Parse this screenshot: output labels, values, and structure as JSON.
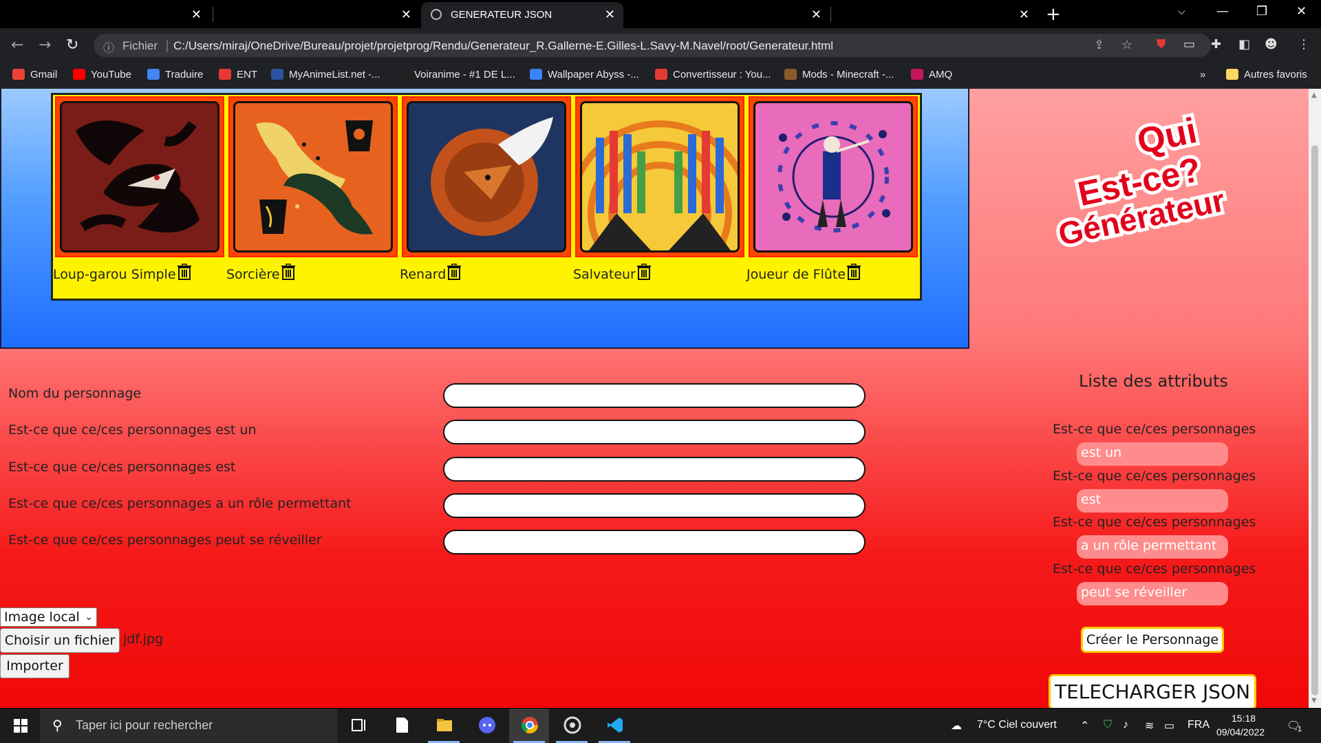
{
  "browser": {
    "active_tab_title": "GENERATEUR JSON",
    "address_scheme": "Fichier",
    "url": "C:/Users/miraj/OneDrive/Bureau/projet/projetprog/Rendu/Generateur_R.Gallerne-E.Gilles-L.Savy-M.Navel/root/Generateur.html",
    "bookmarks": [
      {
        "label": "Gmail",
        "color": "#ea4335"
      },
      {
        "label": "YouTube",
        "color": "#ff0000"
      },
      {
        "label": "Traduire",
        "color": "#4285f4"
      },
      {
        "label": "ENT",
        "color": "#e53935"
      },
      {
        "label": "MyAnimeList.net -...",
        "color": "#2e51a2"
      },
      {
        "label": "Voiranime - #1 DE L...",
        "color": "#222222"
      },
      {
        "label": "Wallpaper Abyss -...",
        "color": "#3b82f6"
      },
      {
        "label": "Convertisseur : You...",
        "color": "#e53935"
      },
      {
        "label": "Mods - Minecraft -...",
        "color": "#8b5a2b"
      },
      {
        "label": "AMQ",
        "color": "#c2185b"
      }
    ],
    "bookmarks_more": "»",
    "other_bookmarks": "Autres favoris"
  },
  "gallery": {
    "cards": [
      {
        "label": "Loup-garou Simple"
      },
      {
        "label": "Sorcière"
      },
      {
        "label": "Renard"
      },
      {
        "label": "Salvateur"
      },
      {
        "label": "Joueur de Flûte"
      }
    ]
  },
  "logo": {
    "line1": "Qui",
    "line2": "Est-ce?",
    "line3": "Générateur"
  },
  "form": {
    "fields": [
      {
        "label": "Nom du personnage",
        "value": ""
      },
      {
        "label": "Est-ce que ce/ces personnages est un",
        "value": ""
      },
      {
        "label": "Est-ce que ce/ces personnages est",
        "value": ""
      },
      {
        "label": "Est-ce que ce/ces personnages a un rôle permettant",
        "value": ""
      },
      {
        "label": "Est-ce que ce/ces personnages peut se réveiller",
        "value": ""
      }
    ],
    "image_source": "Image local",
    "choose_file": "Choisir un fichier",
    "file_name": "jdf.jpg",
    "import": "Importer"
  },
  "attributes": {
    "title": "Liste des attributs",
    "items": [
      {
        "question": "Est-ce que ce/ces personnages",
        "value": "est un"
      },
      {
        "question": "Est-ce que ce/ces personnages",
        "value": "est"
      },
      {
        "question": "Est-ce que ce/ces personnages",
        "value": "a un rôle permettant"
      },
      {
        "question": "Est-ce que ce/ces personnages",
        "value": "peut se réveiller"
      }
    ],
    "create_button": "Créer le Personnage",
    "download_button": "TELECHARGER JSON"
  },
  "taskbar": {
    "search_placeholder": "Taper ici pour rechercher",
    "weather": "7°C  Ciel couvert",
    "language": "FRA",
    "time": "15:18",
    "date": "09/04/2022",
    "notification_count": "1"
  }
}
